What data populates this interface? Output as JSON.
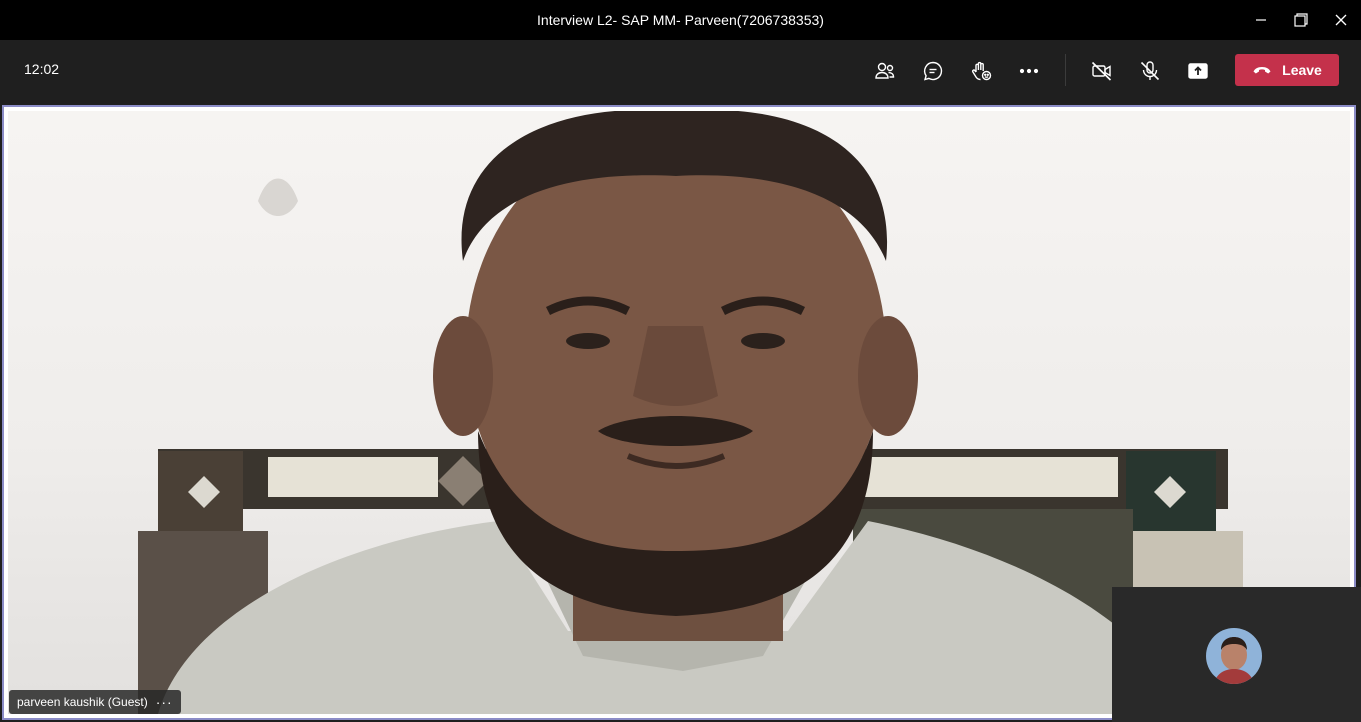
{
  "window": {
    "title": "Interview L2- SAP MM- Parveen(7206738353)",
    "controls": {
      "minimize_icon": "minimize-icon",
      "restore_icon": "restore-icon",
      "close_icon": "close-icon"
    }
  },
  "toolbar": {
    "time": "12:02",
    "buttons": [
      {
        "id": "participants",
        "icon": "people-icon"
      },
      {
        "id": "chat",
        "icon": "chat-icon"
      },
      {
        "id": "reactions",
        "icon": "raise-hand-icon"
      },
      {
        "id": "more",
        "icon": "more-icon"
      },
      {
        "id": "camera",
        "icon": "camera-off-icon"
      },
      {
        "id": "mic",
        "icon": "mic-off-icon"
      },
      {
        "id": "share",
        "icon": "share-screen-icon"
      }
    ],
    "leave": {
      "label": "Leave",
      "icon": "phone-hangup-icon",
      "color": "#c4314b"
    }
  },
  "stage": {
    "active_speaker": {
      "name": "parveen kaushik (Guest)",
      "more_label": "···"
    },
    "highlight_color": "#8b8cc7",
    "self_view": {
      "avatar": "user-avatar"
    }
  }
}
